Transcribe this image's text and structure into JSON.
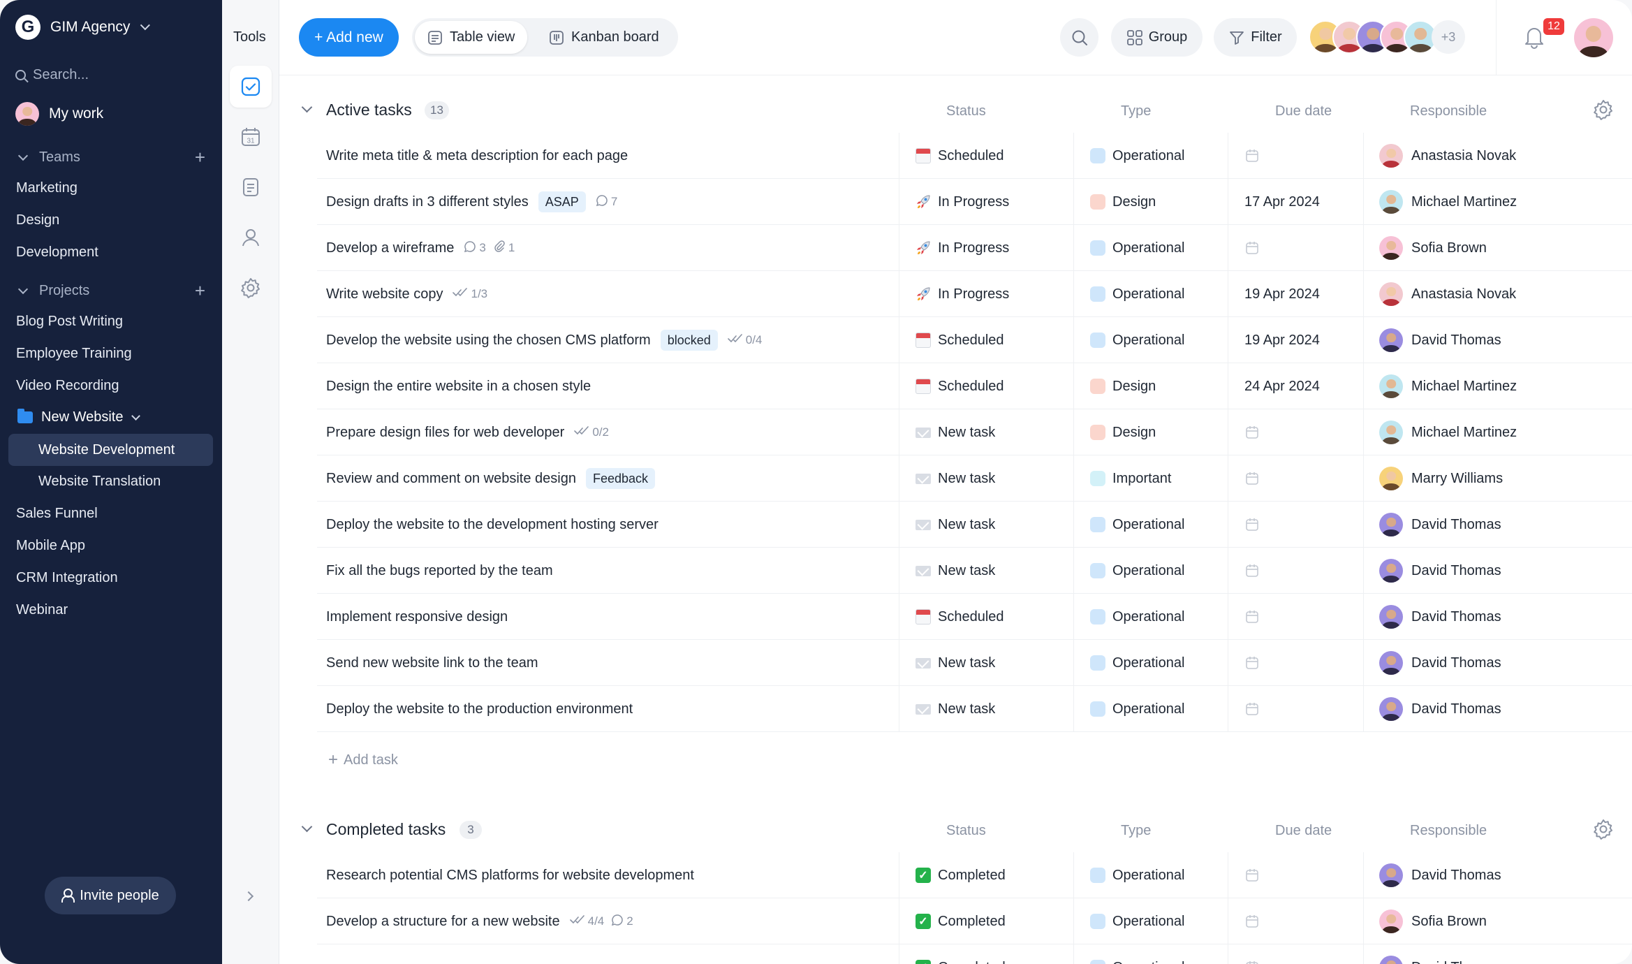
{
  "workspace": {
    "name": "GIM Agency",
    "logo_letter": "G"
  },
  "sidebar": {
    "search_placeholder": "Search...",
    "my_work": "My work",
    "teams_label": "Teams",
    "teams": [
      "Marketing",
      "Design",
      "Development"
    ],
    "projects_label": "Projects",
    "projects_before": [
      "Blog Post Writing",
      "Employee Training",
      "Video Recording"
    ],
    "folder": {
      "label": "New Website",
      "children": [
        "Website Development",
        "Website Translation"
      ]
    },
    "projects_after": [
      "Sales Funnel",
      "Mobile App",
      "CRM Integration",
      "Webinar"
    ],
    "active_item": "Website Development",
    "invite": "Invite people"
  },
  "tools": {
    "title": "Tools",
    "items": [
      "check-square-icon",
      "calendar-icon",
      "notes-icon",
      "user-icon",
      "gear-icon"
    ],
    "calendar_day": "31"
  },
  "topbar": {
    "add_new": "+ Add new",
    "views": [
      "Table view",
      "Kanban board"
    ],
    "active_view": "Table view",
    "group": "Group",
    "filter": "Filter",
    "more_members": "+3",
    "notifications": "12"
  },
  "columns": {
    "status": "Status",
    "type": "Type",
    "due": "Due date",
    "responsible": "Responsible"
  },
  "colors": {
    "accent": "#1b88f2",
    "type": {
      "Operational": "#cfe6fb",
      "Design": "#fbd6cd",
      "Important": "#d3f1f8"
    }
  },
  "people": {
    "Anastasia Novak": {
      "bg": "#f2c9cf",
      "hair": "#b8323a",
      "skin": "#f1c9a8"
    },
    "Michael Martinez": {
      "bg": "#bfe6f0",
      "hair": "#5a4a3a",
      "skin": "#e2b894"
    },
    "Sofia Brown": {
      "bg": "#f7c1d6",
      "hair": "#3b2620",
      "skin": "#e8b99a"
    },
    "David Thomas": {
      "bg": "#9a8ce0",
      "hair": "#2e2a4a",
      "skin": "#d8a98a"
    },
    "Marry Williams": {
      "bg": "#f7d27a",
      "hair": "#6b4a2a",
      "skin": "#f0c8a2"
    }
  },
  "active": {
    "title": "Active tasks",
    "count": "13",
    "tasks": [
      {
        "name": "Write meta title & meta description for each page",
        "status": "Scheduled",
        "type": "Operational",
        "due": "",
        "resp": "Anastasia Novak"
      },
      {
        "name": "Design drafts in 3 different styles",
        "tag": "ASAP",
        "comments": "7",
        "status": "In Progress",
        "type": "Design",
        "due": "17 Apr 2024",
        "resp": "Michael Martinez"
      },
      {
        "name": "Develop a wireframe",
        "comments": "3",
        "attachments": "1",
        "status": "In Progress",
        "type": "Operational",
        "due": "",
        "resp": "Sofia Brown"
      },
      {
        "name": "Write website copy",
        "checks": "1/3",
        "status": "In Progress",
        "type": "Operational",
        "due": "19 Apr 2024",
        "resp": "Anastasia Novak"
      },
      {
        "name": "Develop the website using the chosen CMS platform",
        "tag": "blocked",
        "checks": "0/4",
        "status": "Scheduled",
        "type": "Operational",
        "due": "19 Apr 2024",
        "resp": "David Thomas"
      },
      {
        "name": "Design the entire website in a chosen style",
        "status": "Scheduled",
        "type": "Design",
        "due": "24 Apr 2024",
        "resp": "Michael Martinez"
      },
      {
        "name": "Prepare design files for web developer",
        "checks": "0/2",
        "status": "New task",
        "type": "Design",
        "due": "",
        "resp": "Michael Martinez"
      },
      {
        "name": "Review and comment on website design",
        "tag": "Feedback",
        "status": "New task",
        "type": "Important",
        "due": "",
        "resp": "Marry Williams"
      },
      {
        "name": "Deploy the website to the development hosting server",
        "status": "New task",
        "type": "Operational",
        "due": "",
        "resp": "David Thomas"
      },
      {
        "name": "Fix all the bugs reported by the team",
        "status": "New task",
        "type": "Operational",
        "due": "",
        "resp": "David Thomas"
      },
      {
        "name": "Implement responsive design",
        "status": "Scheduled",
        "type": "Operational",
        "due": "",
        "resp": "David Thomas"
      },
      {
        "name": "Send new website link to the team",
        "status": "New task",
        "type": "Operational",
        "due": "",
        "resp": "David Thomas"
      },
      {
        "name": "Deploy the website to the production environment",
        "status": "New task",
        "type": "Operational",
        "due": "",
        "resp": "David Thomas"
      }
    ],
    "add_task": "Add task"
  },
  "completed": {
    "title": "Completed tasks",
    "count": "3",
    "tasks": [
      {
        "name": "Research potential CMS platforms for website development",
        "status": "Completed",
        "type": "Operational",
        "due": "",
        "resp": "David Thomas"
      },
      {
        "name": "Develop a structure for a new website",
        "checks": "4/4",
        "comments": "2",
        "status": "Completed",
        "type": "Operational",
        "due": "",
        "resp": "Sofia Brown"
      },
      {
        "name": "",
        "status": "Completed",
        "type": "Operational",
        "due": "",
        "resp": "David Thomas"
      }
    ]
  }
}
